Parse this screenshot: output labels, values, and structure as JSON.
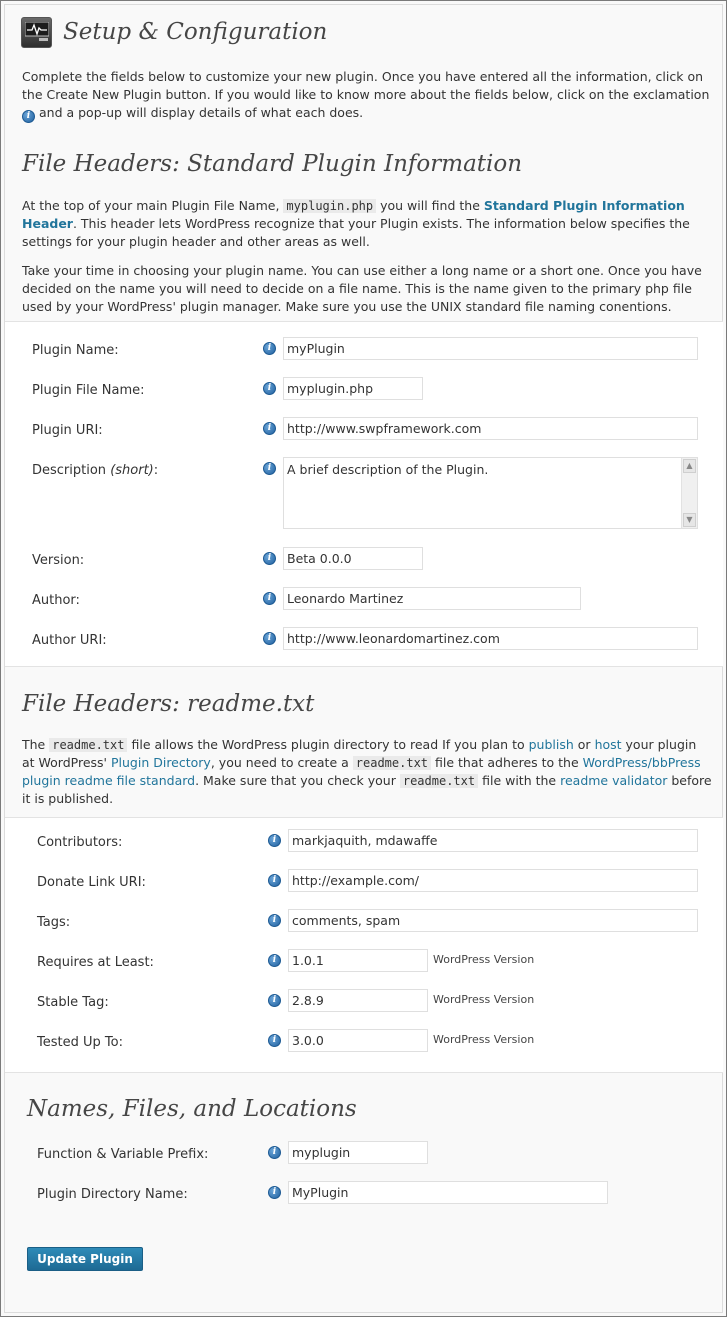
{
  "page": {
    "title": "Setup & Configuration",
    "intro_1": "Complete the fields below to customize your new plugin. Once you have entered all the information, click on the Create New Plugin button. If you would like to know more about the fields below, click on the exclamation",
    "intro_2": "and a pop-up will display details of what each does."
  },
  "standard": {
    "heading": "File Headers: Standard Plugin Information",
    "p1_a": "At the top of your main Plugin File Name,",
    "p1_code": "myplugin.php",
    "p1_b": "you will find the",
    "p1_link": "Standard Plugin Information Header",
    "p1_c": ". This header lets WordPress recognize that your Plugin exists. The information below specifies the settings for your plugin header and other areas as well.",
    "p2": "Take your time in choosing your plugin name. You can use either a long name or a short one. Once you have decided on the name you will need to decide on a file name. This is the name given to the primary php file used by your WordPress' plugin manager. Make sure you use the UNIX standard file naming conentions.",
    "fields": {
      "plugin_name": {
        "label": "Plugin Name:",
        "value": "myPlugin"
      },
      "plugin_file_name": {
        "label": "Plugin File Name:",
        "value": "myplugin.php"
      },
      "plugin_uri": {
        "label": "Plugin URI:",
        "value": "http://www.swpframework.com"
      },
      "description": {
        "label": "Description",
        "label_em": "(short)",
        "label_colon": ":",
        "value": "A brief description of the Plugin."
      },
      "version": {
        "label": "Version:",
        "value": "Beta 0.0.0"
      },
      "author": {
        "label": "Author:",
        "value": "Leonardo Martinez"
      },
      "author_uri": {
        "label": "Author URI:",
        "value": "http://www.leonardomartinez.com"
      }
    }
  },
  "readme": {
    "heading": "File Headers: readme.txt",
    "p_a": "The",
    "p_code1": "readme.txt",
    "p_b": "file allows the WordPress plugin directory to read If you plan to",
    "p_link_publish": "publish",
    "p_or": "or",
    "p_link_host": "host",
    "p_c": "your plugin at WordPress'",
    "p_link_directory": "Plugin Directory",
    "p_d": ", you need to create a",
    "p_code2": "readme.txt",
    "p_e": "file that adheres to the",
    "p_link_standard": "WordPress/bbPress plugin readme file standard",
    "p_f": ". Make sure that you check your",
    "p_code3": "readme.txt",
    "p_g": "file with the",
    "p_link_validator": "readme validator",
    "p_h": "before it is published.",
    "fields": {
      "contributors": {
        "label": "Contributors:",
        "value": "markjaquith, mdawaffe"
      },
      "donate_link": {
        "label": "Donate Link URI:",
        "value": "http://example.com/"
      },
      "tags": {
        "label": "Tags:",
        "value": "comments, spam"
      },
      "requires": {
        "label": "Requires at Least:",
        "value": "1.0.1",
        "hint": "WordPress Version"
      },
      "stable_tag": {
        "label": "Stable Tag:",
        "value": "2.8.9",
        "hint": "WordPress Version"
      },
      "tested_up_to": {
        "label": "Tested Up To:",
        "value": "3.0.0",
        "hint": "WordPress Version"
      }
    }
  },
  "names": {
    "heading": "Names, Files, and Locations",
    "fields": {
      "prefix": {
        "label": "Function & Variable Prefix:",
        "value": "myplugin"
      },
      "directory": {
        "label": "Plugin Directory Name:",
        "value": "MyPlugin"
      }
    }
  },
  "actions": {
    "update_button": "Update Plugin"
  },
  "icons": {
    "info": "info-icon",
    "app": "monitor-icon"
  },
  "colors": {
    "link": "#21759b",
    "button": "#21759b",
    "heading": "#464646"
  }
}
